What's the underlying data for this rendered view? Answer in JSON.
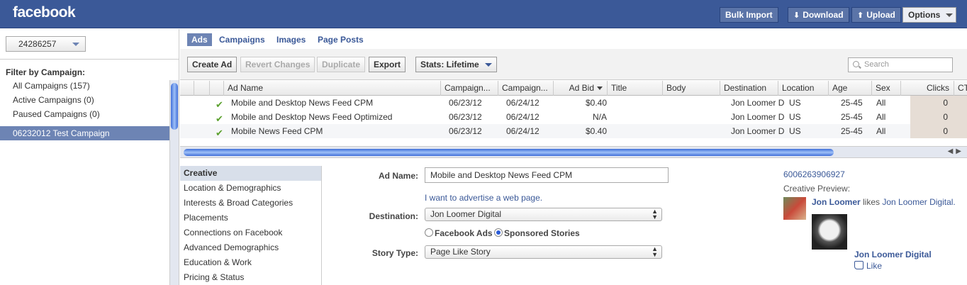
{
  "topbar": {
    "logo": "facebook",
    "bulk_import": "Bulk Import",
    "download": "Download",
    "upload": "Upload",
    "options": "Options"
  },
  "left": {
    "account_id": "24286257",
    "filter_label": "Filter by Campaign:",
    "filters": [
      "All Campaigns (157)",
      "Active Campaigns (0)",
      "Paused Campaigns (0)"
    ],
    "selected_campaign": "06232012 Test Campaign"
  },
  "tabs": [
    "Ads",
    "Campaigns",
    "Images",
    "Page Posts"
  ],
  "toolbar": {
    "create_ad": "Create Ad",
    "revert": "Revert Changes",
    "duplicate": "Duplicate",
    "export": "Export",
    "stats": "Stats: Lifetime",
    "search_placeholder": "Search"
  },
  "table": {
    "columns": [
      "Ad Name",
      "Campaign...",
      "Campaign...",
      "Ad Bid",
      "Title",
      "Body",
      "Destination",
      "Location",
      "Age",
      "Sex",
      "Clicks",
      "CT"
    ],
    "rows": [
      {
        "name": "Mobile and Desktop News Feed CPM",
        "start": "06/23/12",
        "end": "06/24/12",
        "bid": "$0.40",
        "destination": "Jon Loomer Di",
        "location": "US",
        "age": "25-45",
        "sex": "All",
        "clicks": "0"
      },
      {
        "name": "Mobile and Desktop News Feed Optimized",
        "start": "06/23/12",
        "end": "06/24/12",
        "bid": "N/A",
        "destination": "Jon Loomer Di",
        "location": "US",
        "age": "25-45",
        "sex": "All",
        "clicks": "0"
      },
      {
        "name": "Mobile News Feed CPM",
        "start": "06/23/12",
        "end": "06/24/12",
        "bid": "$0.40",
        "destination": "Jon Loomer Di",
        "location": "US",
        "age": "25-45",
        "sex": "All",
        "clicks": "0"
      }
    ]
  },
  "subnav": [
    "Creative",
    "Location & Demographics",
    "Interests & Broad Categories",
    "Placements",
    "Connections on Facebook",
    "Advanced Demographics",
    "Education & Work",
    "Pricing & Status"
  ],
  "form": {
    "ad_name_label": "Ad Name:",
    "ad_name_value": "Mobile and Desktop News Feed CPM",
    "advertise_link": "I want to advertise a web page.",
    "destination_label": "Destination:",
    "destination_value": "Jon Loomer Digital",
    "radio_facebook_ads": "Facebook Ads",
    "radio_sponsored": "Sponsored Stories",
    "story_type_label": "Story Type:",
    "story_type_value": "Page Like Story"
  },
  "preview": {
    "ad_id": "6006263906927",
    "label": "Creative Preview:",
    "user": "Jon Loomer",
    "likes": "likes",
    "page": "Jon Loomer Digital.",
    "page_title": "Jon Loomer Digital",
    "like": "Like"
  },
  "colors": {
    "brand": "#3b5998",
    "selected": "#6d84b4"
  }
}
